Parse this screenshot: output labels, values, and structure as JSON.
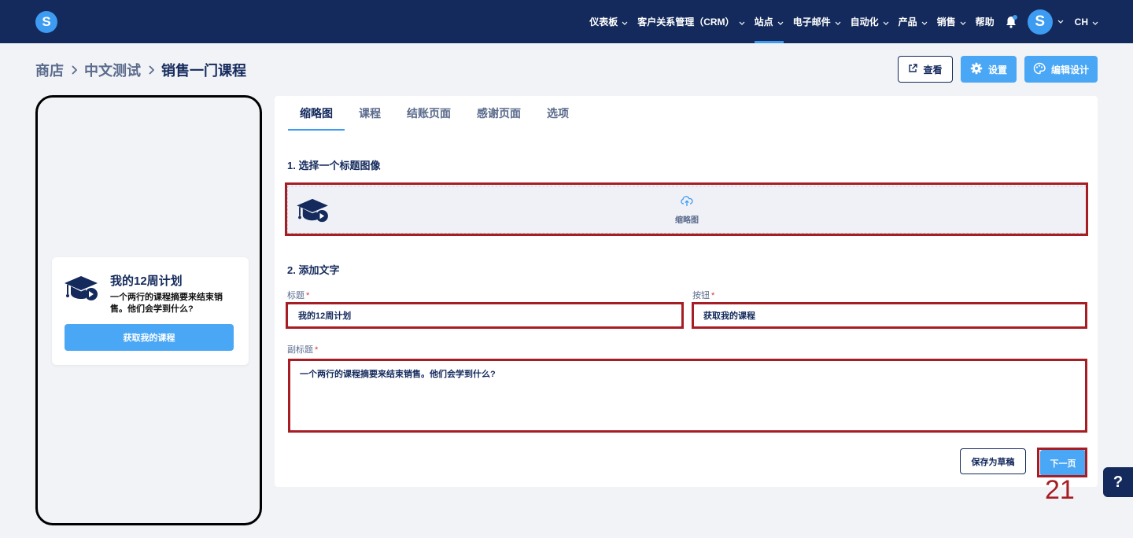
{
  "nav": {
    "logo": "S",
    "items": [
      {
        "label": "仪表板",
        "has_menu": true
      },
      {
        "label": "客户关系管理（CRM）",
        "has_menu": true
      },
      {
        "label": "站点",
        "has_menu": true,
        "active": true
      },
      {
        "label": "电子邮件",
        "has_menu": true
      },
      {
        "label": "自动化",
        "has_menu": true
      },
      {
        "label": "产品",
        "has_menu": true
      },
      {
        "label": "销售",
        "has_menu": true
      },
      {
        "label": "帮助",
        "has_menu": false
      }
    ],
    "avatar": "S",
    "lang": "CH"
  },
  "breadcrumb": [
    "商店",
    "中文测试",
    "销售一门课程"
  ],
  "actions": {
    "view": "查看",
    "settings": "设置",
    "edit_design": "编辑设计"
  },
  "preview": {
    "title": "我的12周计划",
    "subtitle": "一个两行的课程摘要来结束销售。他们会学到什么?",
    "button": "获取我的课程"
  },
  "tabs": [
    "缩略图",
    "课程",
    "结账页面",
    "感谢页面",
    "选项"
  ],
  "form": {
    "section1": "1. 选择一个标题图像",
    "upload_label": "缩略图",
    "section2": "2. 添加文字",
    "title_label": "标题",
    "title_value": "我的12周计划",
    "button_label": "按钮",
    "button_value": "获取我的课程",
    "subtitle_label": "副标题",
    "subtitle_value": "一个两行的课程摘要来结束销售。他们会学到什么?",
    "required_mark": "*"
  },
  "footer": {
    "save_draft": "保存为草稿",
    "next": "下一页"
  },
  "step_number": "21",
  "help": "?",
  "colors": {
    "nav_bg": "#142a5c",
    "accent": "#3d9bf2",
    "button": "#4aa7f5",
    "highlight": "#a71d24"
  }
}
